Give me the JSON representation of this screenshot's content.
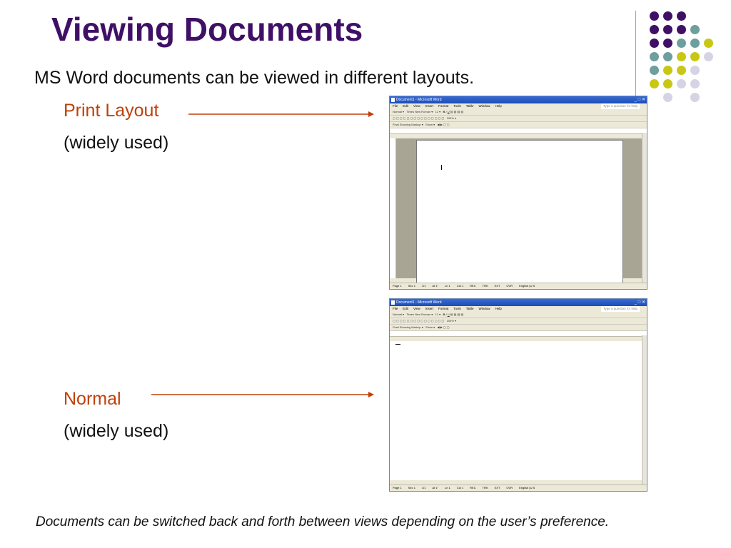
{
  "title": "Viewing Documents",
  "subtitle": "MS Word documents can be viewed in different layouts.",
  "print_layout": {
    "label": "Print Layout",
    "note": "(widely used)"
  },
  "normal_layout": {
    "label": "Normal",
    "note": "(widely used)"
  },
  "caption": "Documents can be switched back and forth between views depending on the user’s preference.",
  "colors": {
    "title": "#3f1066",
    "accent_red": "#c0400a",
    "purple": "#3f1066",
    "teal": "#6e9e9e",
    "yellow": "#c8c814",
    "lavender": "#d4d4e4"
  },
  "word_window": {
    "title": "Document1 - Microsoft Word",
    "menu": [
      "File",
      "Edit",
      "View",
      "Insert",
      "Format",
      "Tools",
      "Table",
      "Window",
      "Help"
    ],
    "help_placeholder": "Type a question for help",
    "style": "Normal",
    "font": "Times New Roman",
    "size": "12",
    "zoom": "100%",
    "markup": "Final Showing Markup",
    "show": "Show",
    "status": [
      "Page 1",
      "Sec 1",
      "1/1",
      "At 1\"",
      "Ln 1",
      "Col 1",
      "REC",
      "TRK",
      "EXT",
      "OVR",
      "English (U.S"
    ]
  }
}
